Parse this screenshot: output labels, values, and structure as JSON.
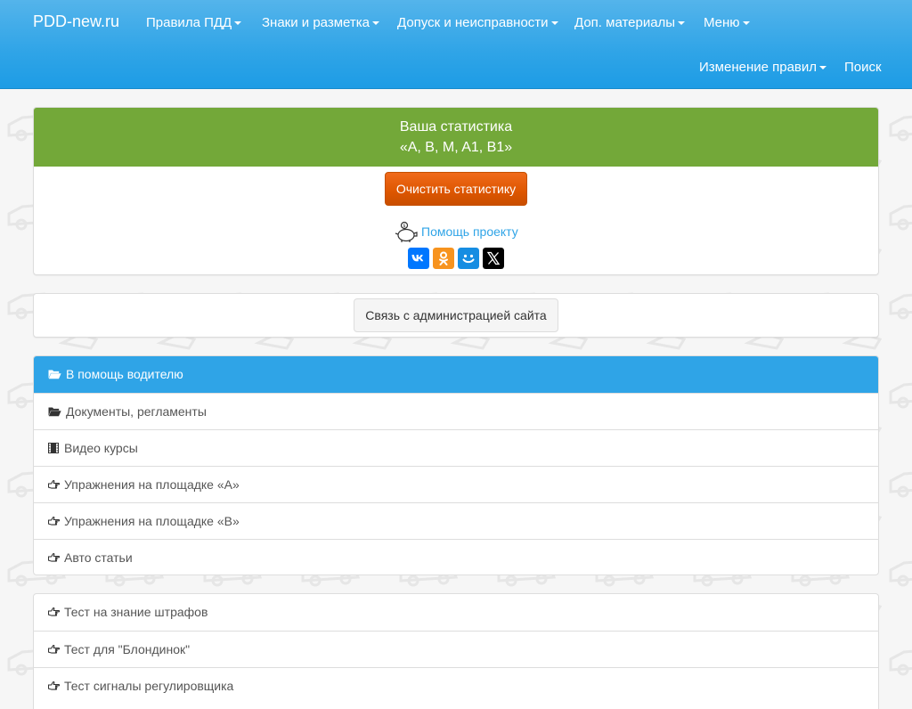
{
  "navbar": {
    "brand": "PDD-new.ru",
    "items": [
      {
        "label": "Правила ПДД",
        "dropdown": true
      },
      {
        "label": "Знаки и разметка",
        "dropdown": true
      },
      {
        "label": "Допуск и неисправности",
        "dropdown": true
      },
      {
        "label": "Доп. материалы",
        "dropdown": true
      },
      {
        "label": "Меню",
        "dropdown": true
      },
      {
        "label": "Изменение правил",
        "dropdown": true
      },
      {
        "label": "Поиск",
        "dropdown": false
      }
    ]
  },
  "stats": {
    "title": "Ваша статистика",
    "categories": "«A, B, M, A1, B1»",
    "clear_button": "Очистить статистику",
    "help_link": "Помощь проекту",
    "social": [
      "vk-icon",
      "odnoklassniki-icon",
      "moimir-icon",
      "x-icon"
    ]
  },
  "admin": {
    "contact_button": "Связь с администрацией сайта"
  },
  "menu1": {
    "items": [
      {
        "label": "В помощь водителю",
        "icon": "folder-open-icon",
        "active": true
      },
      {
        "label": "Документы, регламенты",
        "icon": "folder-open-icon",
        "active": false
      },
      {
        "label": "Видео курсы",
        "icon": "film-icon",
        "active": false
      },
      {
        "label": "Упражнения на площадке «А»",
        "icon": "hand-right-icon",
        "active": false
      },
      {
        "label": "Упражнения на площадке «В»",
        "icon": "hand-right-icon",
        "active": false
      },
      {
        "label": "Авто статьи",
        "icon": "hand-right-icon",
        "active": false
      }
    ]
  },
  "menu2": {
    "items": [
      {
        "label": "Тест на знание штрафов",
        "icon": "hand-right-icon"
      },
      {
        "label": "Тест для \"Блондинок\"",
        "icon": "hand-right-icon"
      },
      {
        "label": "Тест сигналы регулировщика",
        "icon": "hand-right-icon"
      }
    ]
  },
  "colors": {
    "navbar": "#2fa4e7",
    "stats_header": "#73a839",
    "clear_button": "#dd5600",
    "active_item": "#2fa4e7",
    "vk": "#0077ff",
    "ok": "#f7931e",
    "moimir": "#168de2",
    "x": "#000000"
  }
}
